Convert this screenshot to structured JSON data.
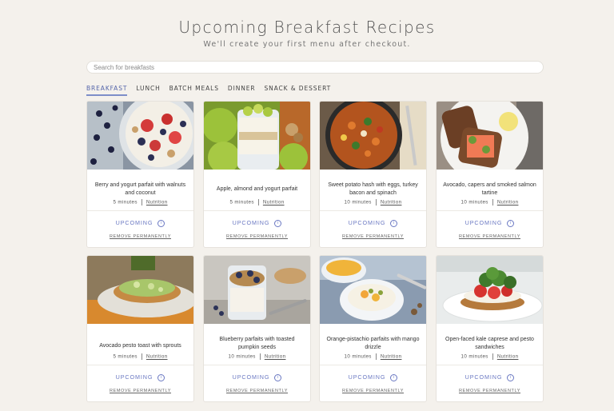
{
  "header": {
    "title": "Upcoming Breakfast Recipes",
    "subtitle": "We'll create your first menu after checkout."
  },
  "search": {
    "placeholder": "Search for breakfasts",
    "value": ""
  },
  "tabs": [
    {
      "label": "BREAKFAST",
      "active": true
    },
    {
      "label": "LUNCH",
      "active": false
    },
    {
      "label": "BATCH MEALS",
      "active": false
    },
    {
      "label": "DINNER",
      "active": false
    },
    {
      "label": "SNACK & DESSERT",
      "active": false
    }
  ],
  "card_labels": {
    "nutrition": "Nutrition",
    "upcoming": "UPCOMING",
    "info_glyph": "i",
    "remove": "REMOVE PERMANENTLY"
  },
  "recipes": [
    {
      "title": "Berry and yogurt parfait with walnuts and coconut",
      "time": "5 minutes",
      "image": "berry-yogurt-parfait-photo"
    },
    {
      "title": "Apple, almond and yogurt parfait",
      "time": "5 minutes",
      "image": "apple-almond-parfait-photo"
    },
    {
      "title": "Sweet potato hash with eggs, turkey bacon and spinach",
      "time": "10 minutes",
      "image": "sweet-potato-hash-photo"
    },
    {
      "title": "Avocado, capers and smoked salmon tartine",
      "time": "10 minutes",
      "image": "salmon-tartine-photo"
    },
    {
      "title": "Avocado pesto toast with sprouts",
      "time": "5 minutes",
      "image": "pesto-toast-photo"
    },
    {
      "title": "Blueberry parfaits with toasted pumpkin seeds",
      "time": "10 minutes",
      "image": "blueberry-parfait-photo"
    },
    {
      "title": "Orange-pistachio parfaits with mango drizzle",
      "time": "10 minutes",
      "image": "orange-pistachio-parfait-photo"
    },
    {
      "title": "Open-faced kale caprese and pesto sandwiches",
      "time": "10 minutes",
      "image": "kale-caprese-sandwich-photo"
    }
  ],
  "colors": {
    "background": "#f4f1ec",
    "accent": "#6a78c2",
    "card": "#ffffff"
  }
}
